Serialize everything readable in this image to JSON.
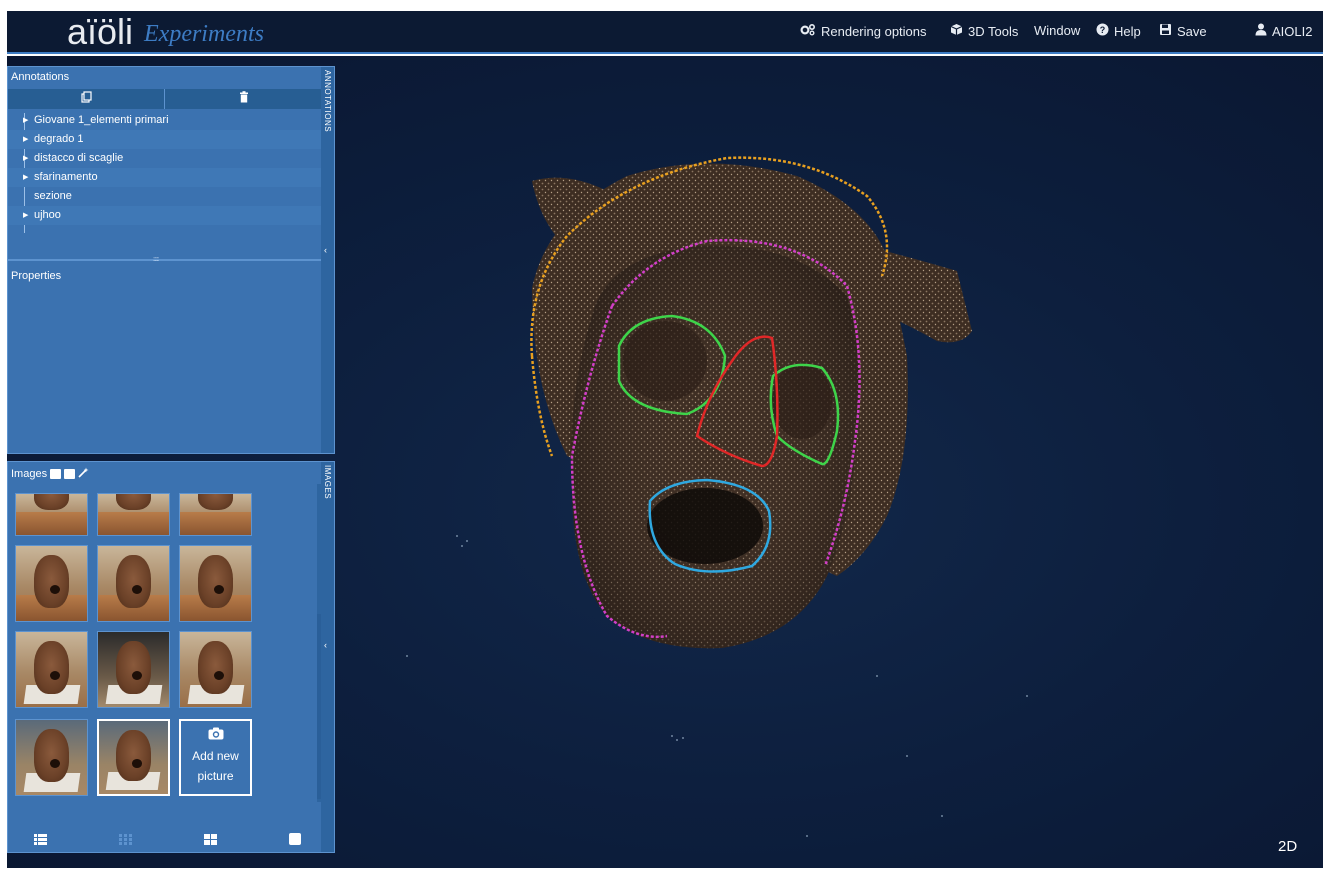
{
  "header": {
    "logo_main": "aïöli",
    "logo_sub": "Experiments",
    "menu": [
      {
        "label": "Rendering options",
        "icon": "gears-icon"
      },
      {
        "label": "3D Tools",
        "icon": "cube-icon"
      },
      {
        "label": "Window",
        "icon": ""
      },
      {
        "label": "Help",
        "icon": "help-circle-icon"
      },
      {
        "label": "Save",
        "icon": "floppy-disk-icon"
      }
    ],
    "user": "AIOLI2"
  },
  "annotations_panel": {
    "title": "Annotations",
    "side_label": "ANNOTATIONS",
    "items": [
      {
        "label": "Giovane 1_elementi primari",
        "has_children": true
      },
      {
        "label": "degrado 1",
        "has_children": true
      },
      {
        "label": "distacco di scaglie",
        "has_children": true
      },
      {
        "label": "sfarinamento",
        "has_children": true
      },
      {
        "label": "sezione",
        "has_children": false
      },
      {
        "label": "ujhoo",
        "has_children": true
      }
    ]
  },
  "properties_panel": {
    "title": "Properties"
  },
  "images_panel": {
    "title": "Images",
    "side_label": "IMAGES",
    "add_picture_line1": "Add new",
    "add_picture_line2": "picture",
    "thumbnail_count": 11,
    "selected_thumbnail": 11
  },
  "viewer": {
    "mode_label": "2D"
  },
  "colors": {
    "topbar": "#0c1a33",
    "panel": "#3b72b0",
    "accent": "#3d7cc4",
    "annotation_outline_orange": "#e8a020",
    "annotation_outline_magenta": "#d23fc8",
    "annotation_outline_green": "#3ed44a",
    "annotation_outline_red": "#e02828",
    "annotation_outline_cyan": "#2fa8e0"
  }
}
